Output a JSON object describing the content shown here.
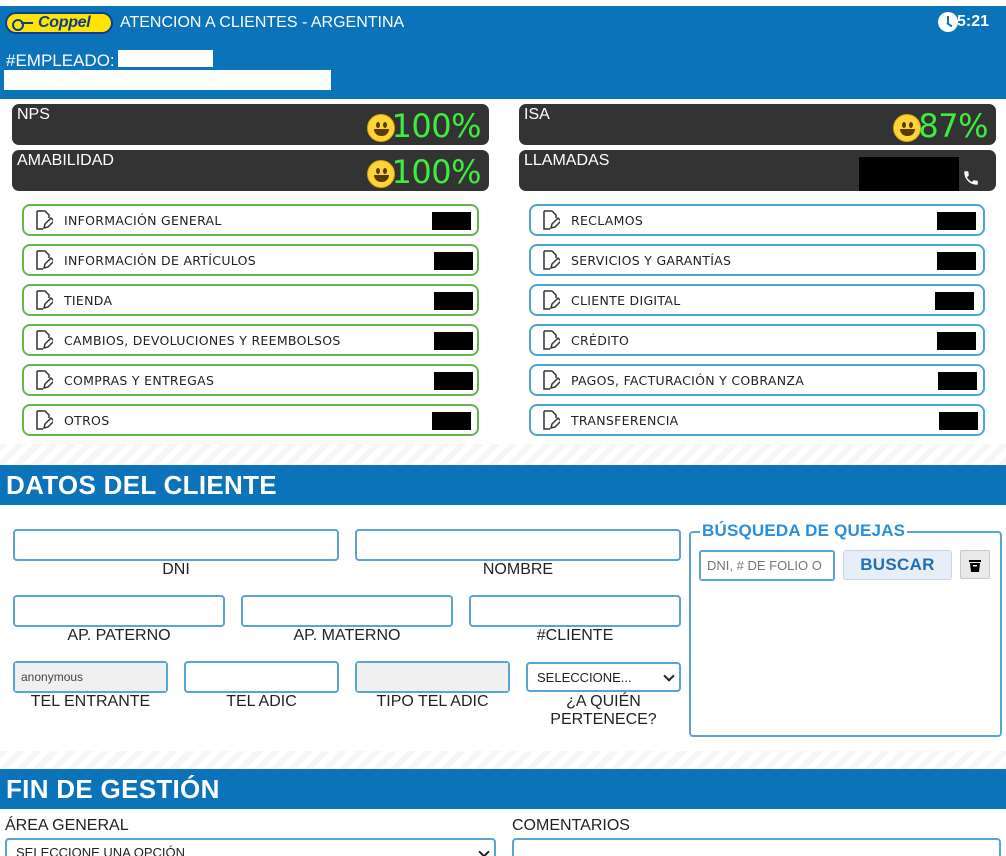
{
  "header": {
    "brand": "Coppel",
    "title": "ATENCION A CLIENTES - ARGENTINA",
    "time": "5:21",
    "employee_label": "#EMPLEADO:"
  },
  "kpis": {
    "nps": {
      "label": "NPS",
      "value": "100%"
    },
    "isa": {
      "label": "ISA",
      "value": "87%"
    },
    "amabilidad": {
      "label": "AMABILIDAD",
      "value": "100%"
    },
    "llamadas": {
      "label": "LLAMADAS"
    },
    "value_color": "#3cee3c"
  },
  "categories_left": [
    {
      "label": "INFORMACIÓN GENERAL"
    },
    {
      "label": "INFORMACIÓN DE ARTÍCULOS"
    },
    {
      "label": "TIENDA"
    },
    {
      "label": "CAMBIOS, DEVOLUCIONES Y REEMBOLSOS"
    },
    {
      "label": "COMPRAS Y ENTREGAS"
    },
    {
      "label": "OTROS"
    }
  ],
  "categories_right": [
    {
      "label": "RECLAMOS"
    },
    {
      "label": "SERVICIOS Y GARANTÍAS"
    },
    {
      "label": "CLIENTE DIGITAL"
    },
    {
      "label": "CRÉDITO"
    },
    {
      "label": "PAGOS, FACTURACIÓN Y COBRANZA"
    },
    {
      "label": "TRANSFERENCIA"
    }
  ],
  "client": {
    "section_title": "DATOS DEL CLIENTE",
    "dni_label": "DNI",
    "nombre_label": "NOMBRE",
    "ap_paterno_label": "AP. PATERNO",
    "ap_materno_label": "AP. MATERNO",
    "cliente_label": "#CLIENTE",
    "tel_entrante_label": "TEL ENTRANTE",
    "tel_entrante_value": "anonymous",
    "tel_adic_label": "TEL ADIC",
    "tipo_tel_label": "TIPO TEL ADIC",
    "pertenece_select": "SELECCIONE...",
    "pertenece_label": "¿A QUIÉN PERTENECE?"
  },
  "quejas": {
    "title": "BÚSQUEDA DE QUEJAS",
    "placeholder": "DNI, # DE FOLIO O",
    "buscar_label": "BUSCAR"
  },
  "fin": {
    "section_title": "FIN DE GESTIÓN",
    "area_label": "ÁREA GENERAL",
    "area_select": "SELECCIONE UNA OPCIÓN",
    "comentarios_label": "COMENTARIOS"
  },
  "colors": {
    "primary": "#0b73b9",
    "kpi_panel": "#333333",
    "green_border": "#62b74a",
    "blue_border": "#4aa6d2",
    "accent_title": "#2a8ee0"
  }
}
